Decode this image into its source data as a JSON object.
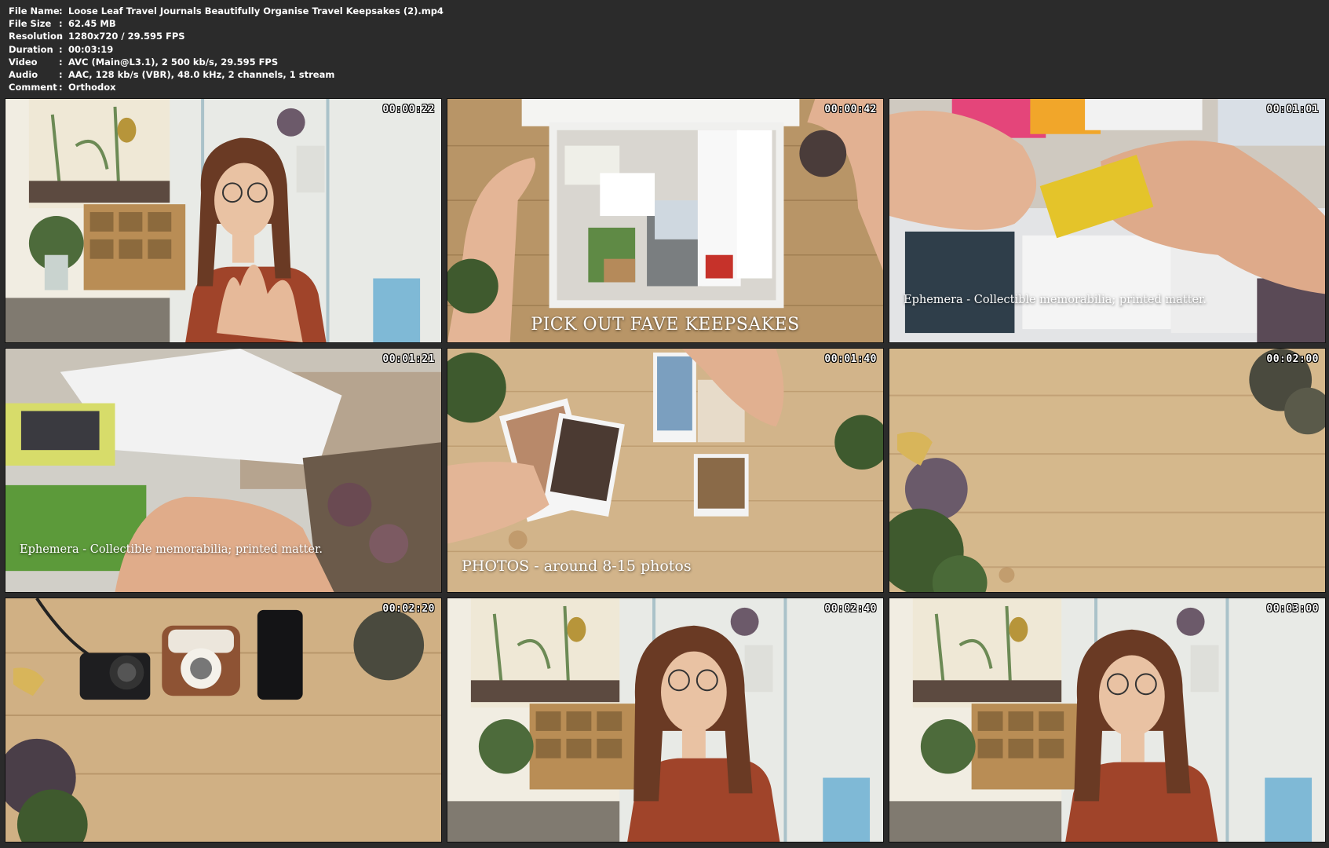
{
  "meta": {
    "rows": [
      {
        "key": "File Name",
        "sep": ":",
        "value": "Loose Leaf Travel Journals Beautifully Organise Travel Keepsakes (2).mp4"
      },
      {
        "key": "File Size",
        "sep": ":",
        "value": "62.45 MB"
      },
      {
        "key": "Resolution",
        "sep": ":",
        "value": "1280x720 / 29.595 FPS"
      },
      {
        "key": "Duration",
        "sep": ":",
        "value": "00:03:19"
      },
      {
        "key": "Video",
        "sep": ":",
        "value": "AVC (Main@L3.1), 2 500 kb/s, 29.595 FPS"
      },
      {
        "key": "Audio",
        "sep": ":",
        "value": "AAC, 128 kb/s (VBR), 48.0 kHz, 2 channels, 1 stream"
      },
      {
        "key": "Comment",
        "sep": ":",
        "value": "Orthodox"
      }
    ]
  },
  "thumbs": [
    {
      "time": "00:00:22",
      "caption": ""
    },
    {
      "time": "00:00:42",
      "caption": "PICK OUT FAVE KEEPSAKES"
    },
    {
      "time": "00:01:01",
      "caption": "Ephemera - Collectible memorabilia; printed matter."
    },
    {
      "time": "00:01:21",
      "caption": "Ephemera - Collectible memorabilia; printed matter."
    },
    {
      "time": "00:01:40",
      "caption": "PHOTOS - around 8-15 photos"
    },
    {
      "time": "00:02:00",
      "caption": ""
    },
    {
      "time": "00:02:20",
      "caption": ""
    },
    {
      "time": "00:02:40",
      "caption": ""
    },
    {
      "time": "00:03:00",
      "caption": ""
    }
  ],
  "colors": {
    "background": "#2b2b2b",
    "wood": "#c9a878",
    "wall": "#e9ebe6",
    "top": "#a0442a"
  }
}
